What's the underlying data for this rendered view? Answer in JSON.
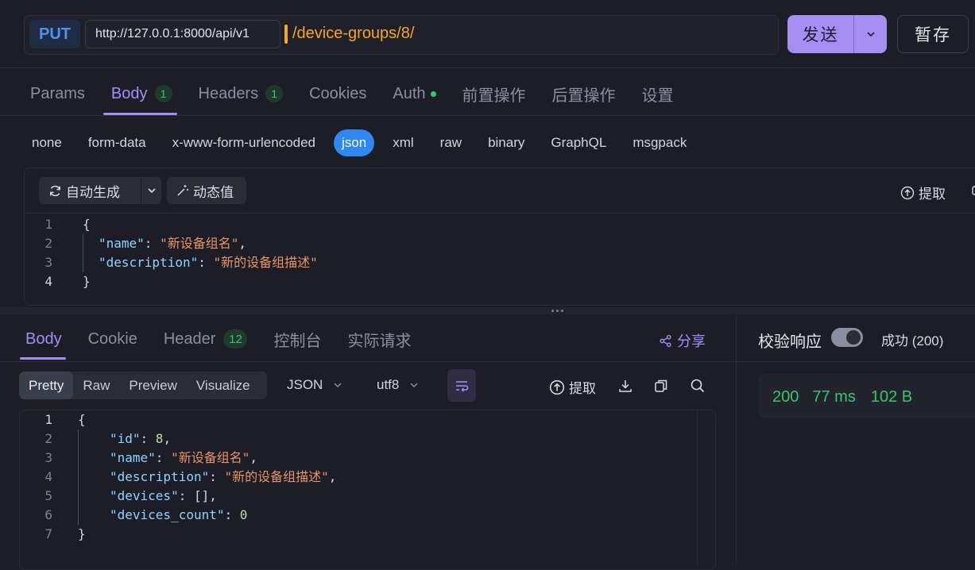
{
  "request": {
    "method": "PUT",
    "base_url": "http://127.0.0.1:8000/api/v1",
    "path": "/device-groups/8/",
    "send_label": "发送",
    "save_label": "暂存"
  },
  "req_tabs": [
    {
      "label": "Params",
      "badge": ""
    },
    {
      "label": "Body",
      "badge": "1"
    },
    {
      "label": "Headers",
      "badge": "1"
    },
    {
      "label": "Cookies",
      "badge": ""
    },
    {
      "label": "Auth",
      "badge": ""
    },
    {
      "label": "前置操作",
      "badge": ""
    },
    {
      "label": "后置操作",
      "badge": ""
    },
    {
      "label": "设置",
      "badge": ""
    }
  ],
  "body_types": [
    "none",
    "form-data",
    "x-www-form-urlencoded",
    "json",
    "xml",
    "raw",
    "binary",
    "GraphQL",
    "msgpack"
  ],
  "editor": {
    "autogen_label": "自动生成",
    "dynamic_label": "动态值",
    "extract_label": "提取",
    "line_numbers": [
      "1",
      "2",
      "3",
      "4"
    ],
    "open_brace": "{",
    "close_brace": "}",
    "fields": [
      {
        "key": "\"name\"",
        "value": "\"新设备组名\"",
        "trail": ","
      },
      {
        "key": "\"description\"",
        "value": "\"新的设备组描述\"",
        "trail": ""
      }
    ]
  },
  "response": {
    "tabs": [
      {
        "label": "Body",
        "badge": ""
      },
      {
        "label": "Cookie",
        "badge": ""
      },
      {
        "label": "Header",
        "badge": "12"
      },
      {
        "label": "控制台",
        "badge": ""
      },
      {
        "label": "实际请求",
        "badge": ""
      }
    ],
    "share_label": "分享",
    "view_modes": [
      "Pretty",
      "Raw",
      "Preview",
      "Visualize"
    ],
    "format": "JSON",
    "encoding": "utf8",
    "extract_label": "提取",
    "line_numbers": [
      "1",
      "2",
      "3",
      "4",
      "5",
      "6",
      "7"
    ],
    "open_brace": "{",
    "close_brace": "}",
    "fields": [
      {
        "key": "\"id\"",
        "value": "8",
        "trail": ",",
        "type": "number"
      },
      {
        "key": "\"name\"",
        "value": "\"新设备组名\"",
        "trail": ",",
        "type": "string"
      },
      {
        "key": "\"description\"",
        "value": "\"新的设备组描述\"",
        "trail": ",",
        "type": "string"
      },
      {
        "key": "\"devices\"",
        "value": "[]",
        "trail": ",",
        "type": "punct"
      },
      {
        "key": "\"devices_count\"",
        "value": "0",
        "trail": "",
        "type": "number"
      }
    ]
  },
  "validation": {
    "label": "校验响应",
    "enabled": true,
    "result": "成功 (200)",
    "status": "200",
    "time": "77 ms",
    "size": "102 B"
  }
}
